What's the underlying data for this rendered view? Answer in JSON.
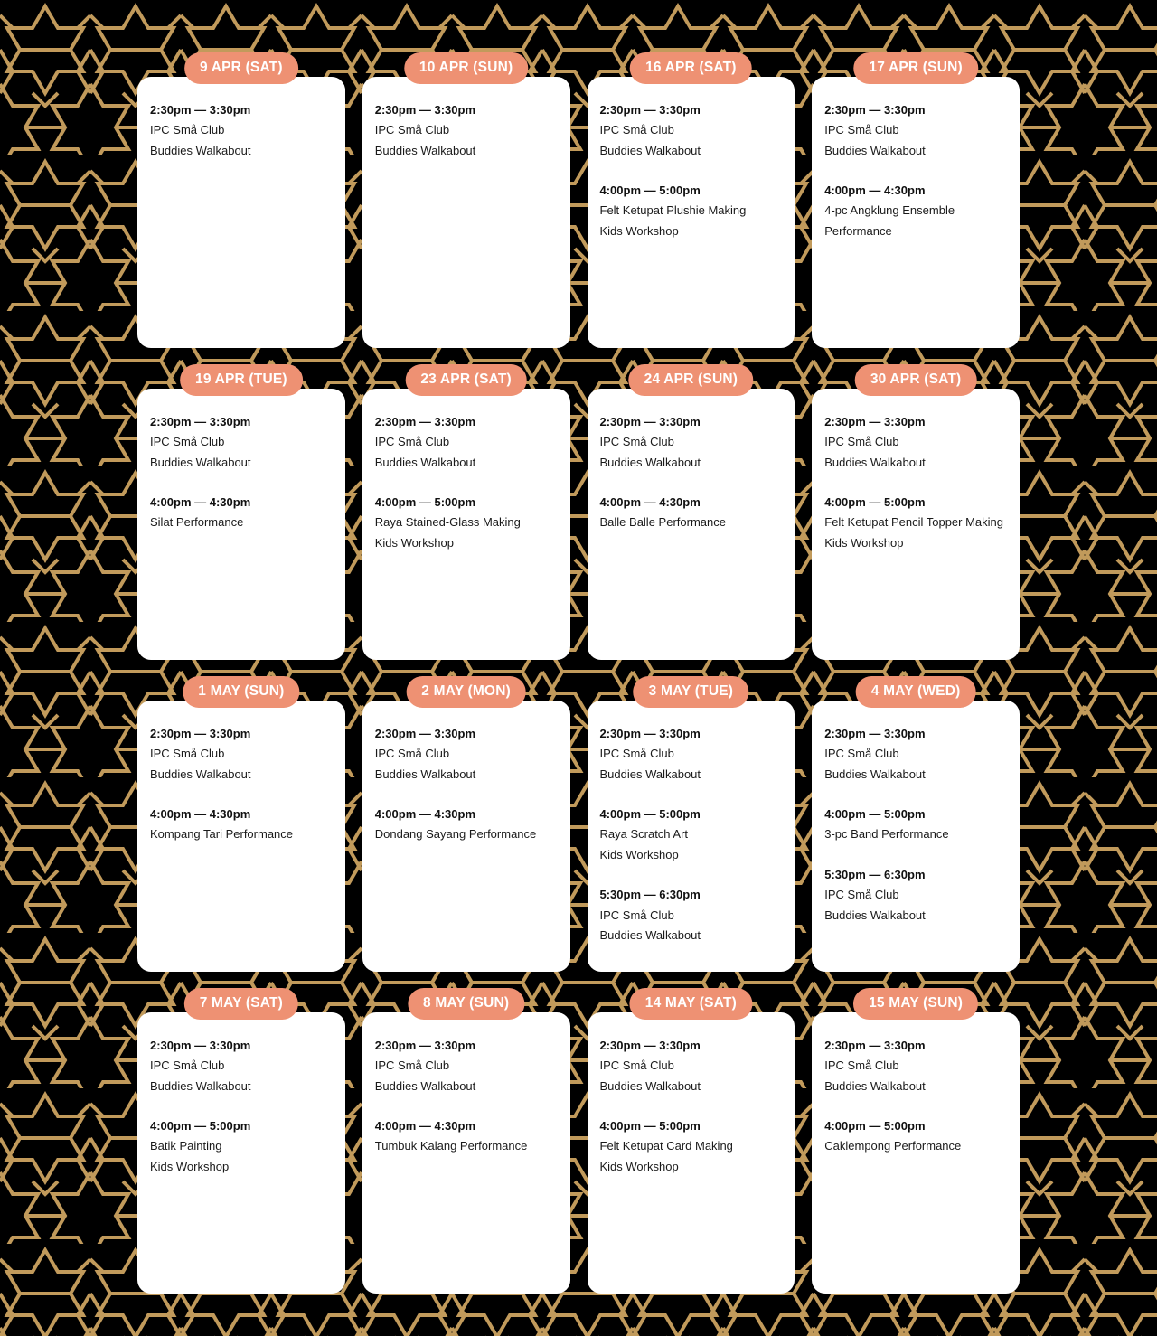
{
  "theme": {
    "background_color": "#000000",
    "pattern_color": "#C19A5B",
    "card_color": "#FFFFFF",
    "badge_color": "#EE9173",
    "badge_text_color": "#FFFFFF",
    "text_color": "#1A1A1A"
  },
  "calendar": {
    "days": [
      {
        "date_label": "9 APR (SAT)",
        "blocks": [
          {
            "time": "2:30pm —  3:30pm",
            "lines": [
              "IPC Små Club",
              "Buddies Walkabout"
            ]
          }
        ]
      },
      {
        "date_label": "10 APR (SUN)",
        "blocks": [
          {
            "time": "2:30pm —  3:30pm",
            "lines": [
              "IPC Små Club",
              "Buddies Walkabout"
            ]
          }
        ]
      },
      {
        "date_label": "16 APR (SAT)",
        "blocks": [
          {
            "time": "2:30pm —  3:30pm",
            "lines": [
              "IPC Små Club",
              "Buddies Walkabout"
            ]
          },
          {
            "time": "4:00pm — 5:00pm",
            "lines": [
              "Felt Ketupat Plushie Making",
              "Kids Workshop"
            ]
          }
        ]
      },
      {
        "date_label": "17 APR (SUN)",
        "blocks": [
          {
            "time": "2:30pm —  3:30pm",
            "lines": [
              "IPC Små Club",
              "Buddies Walkabout"
            ]
          },
          {
            "time": "4:00pm — 4:30pm",
            "lines": [
              "4-pc Angklung Ensemble",
              "Performance"
            ]
          }
        ]
      },
      {
        "date_label": "19 APR (TUE)",
        "blocks": [
          {
            "time": "2:30pm — 3:30pm",
            "lines": [
              "IPC Små Club",
              "Buddies Walkabout"
            ]
          },
          {
            "time": "4:00pm —  4:30pm",
            "lines": [
              "Silat Performance"
            ]
          }
        ]
      },
      {
        "date_label": "23 APR (SAT)",
        "blocks": [
          {
            "time": "2:30pm —  3:30pm",
            "lines": [
              "IPC Små Club",
              "Buddies Walkabout"
            ]
          },
          {
            "time": "4:00pm — 5:00pm",
            "lines": [
              "Raya Stained-Glass Making",
              "Kids Workshop"
            ]
          }
        ]
      },
      {
        "date_label": "24 APR (SUN)",
        "blocks": [
          {
            "time": "2:30pm —  3:30pm",
            "lines": [
              "IPC Små Club",
              "Buddies Walkabout"
            ]
          },
          {
            "time": "4:00pm —  4:30pm",
            "lines": [
              "Balle Balle Performance"
            ]
          }
        ]
      },
      {
        "date_label": "30 APR (SAT)",
        "blocks": [
          {
            "time": "2:30pm —  3:30pm",
            "lines": [
              "IPC Små Club",
              "Buddies Walkabout"
            ]
          },
          {
            "time": "4:00pm — 5:00pm",
            "lines": [
              "Felt Ketupat Pencil Topper Making",
              "Kids Workshop"
            ]
          }
        ]
      },
      {
        "date_label": "1 MAY (SUN)",
        "blocks": [
          {
            "time": "2:30pm —  3:30pm",
            "lines": [
              "IPC Små Club",
              "Buddies Walkabout"
            ]
          },
          {
            "time": "4:00pm — 4:30pm",
            "lines": [
              "Kompang Tari Performance"
            ]
          }
        ]
      },
      {
        "date_label": "2 MAY (MON)",
        "blocks": [
          {
            "time": "2:30pm — 3:30pm",
            "lines": [
              "IPC Små Club",
              "Buddies Walkabout"
            ]
          },
          {
            "time": "4:00pm — 4:30pm",
            "lines": [
              "Dondang Sayang Performance"
            ]
          }
        ]
      },
      {
        "date_label": "3 MAY (TUE)",
        "blocks": [
          {
            "time": "2:30pm — 3:30pm",
            "lines": [
              "IPC Små Club",
              "Buddies Walkabout"
            ]
          },
          {
            "time": "4:00pm —  5:00pm",
            "lines": [
              "Raya Scratch Art",
              "Kids Workshop"
            ]
          },
          {
            "time": "5:30pm —  6:30pm",
            "lines": [
              "IPC Små Club",
              "Buddies Walkabout"
            ]
          }
        ]
      },
      {
        "date_label": "4 MAY (WED)",
        "blocks": [
          {
            "time": "2:30pm — 3:30pm",
            "lines": [
              "IPC Små Club",
              "Buddies Walkabout"
            ]
          },
          {
            "time": "4:00pm — 5:00pm",
            "lines": [
              "3-pc Band Performance"
            ]
          },
          {
            "time": "5:30pm —  6:30pm",
            "lines": [
              "IPC Små Club",
              "Buddies Walkabout"
            ]
          }
        ]
      },
      {
        "date_label": "7 MAY (SAT)",
        "blocks": [
          {
            "time": "2:30pm —  3:30pm",
            "lines": [
              "IPC Små Club",
              "Buddies Walkabout"
            ]
          },
          {
            "time": "4:00pm — 5:00pm",
            "lines": [
              "Batik Painting",
              "Kids Workshop"
            ]
          }
        ]
      },
      {
        "date_label": "8 MAY (SUN)",
        "blocks": [
          {
            "time": "2:30pm — 3:30pm",
            "lines": [
              "IPC Små Club",
              "Buddies Walkabout"
            ]
          },
          {
            "time": "4:00pm — 4:30pm",
            "lines": [
              "Tumbuk Kalang Performance"
            ]
          }
        ]
      },
      {
        "date_label": "14 MAY (SAT)",
        "blocks": [
          {
            "time": "2:30pm — 3:30pm",
            "lines": [
              "IPC Små Club",
              "Buddies Walkabout"
            ]
          },
          {
            "time": "4:00pm —  5:00pm",
            "lines": [
              "Felt Ketupat Card Making",
              "Kids Workshop"
            ]
          }
        ]
      },
      {
        "date_label": "15 MAY (SUN)",
        "blocks": [
          {
            "time": "2:30pm — 3:30pm",
            "lines": [
              "IPC Små Club",
              "Buddies Walkabout"
            ]
          },
          {
            "time": "4:00pm — 5:00pm",
            "lines": [
              "Caklempong Performance"
            ]
          }
        ]
      }
    ]
  }
}
